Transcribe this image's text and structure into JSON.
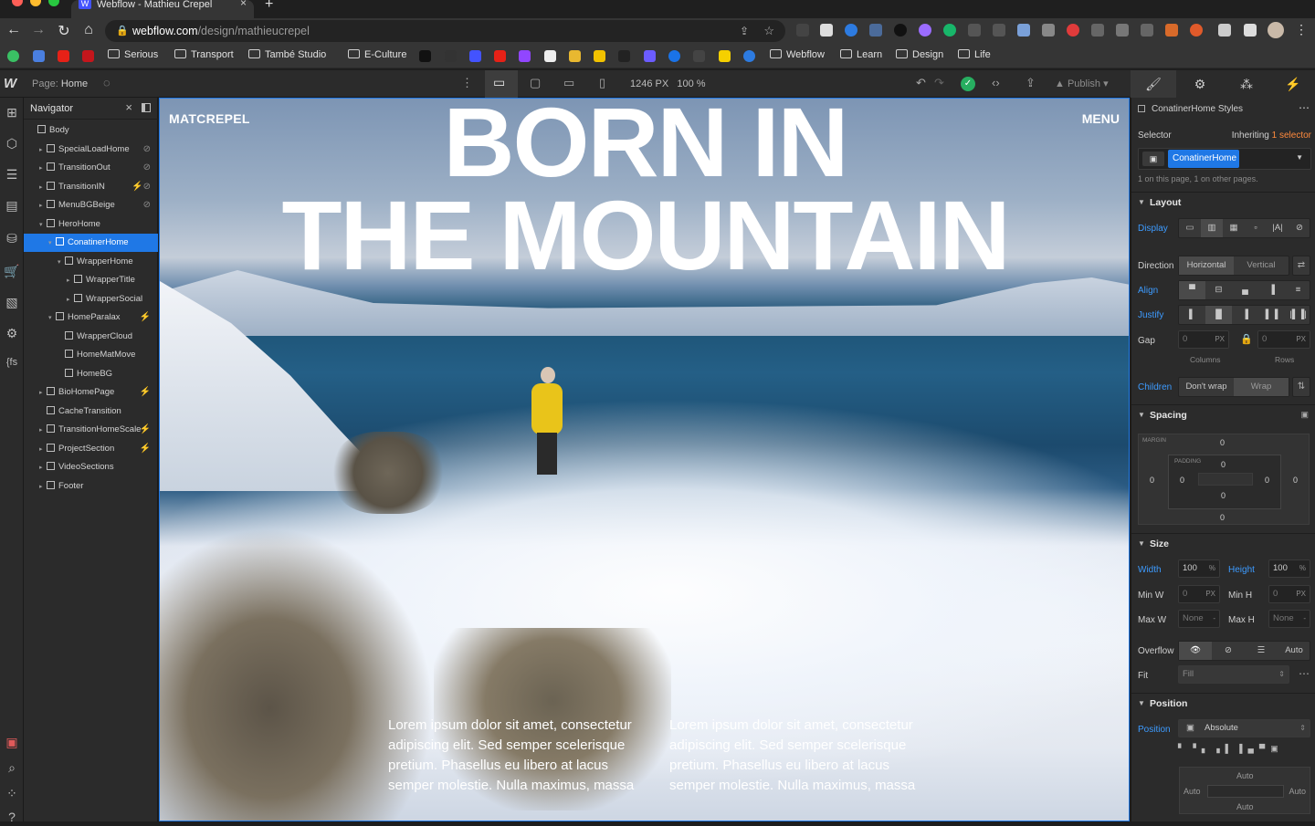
{
  "browser": {
    "tab_title": "Webflow - Mathieu Crepel",
    "tab_favicon": "W",
    "url_host": "webflow.com",
    "url_path": "/design/mathieucrepel",
    "bookmarks": [
      "Serious",
      "Transport",
      "També Studio",
      "E-Culture",
      "Webflow",
      "Learn",
      "Design",
      "Life"
    ]
  },
  "wf_topbar": {
    "page_label": "Page:",
    "page_name": "Home",
    "canvas_width": "1246 PX",
    "zoom": "100 %",
    "publish": "Publish"
  },
  "navigator": {
    "title": "Navigator",
    "items": [
      {
        "label": "Body",
        "depth": 0,
        "caret": "",
        "action": ""
      },
      {
        "label": "SpecialLoadHome",
        "depth": 1,
        "caret": "▸",
        "action": "⊘"
      },
      {
        "label": "TransitionOut",
        "depth": 1,
        "caret": "▸",
        "action": "⊘"
      },
      {
        "label": "TransitionIN",
        "depth": 1,
        "caret": "▸",
        "action": "⚡⊘"
      },
      {
        "label": "MenuBGBeige",
        "depth": 1,
        "caret": "▸",
        "action": "⊘"
      },
      {
        "label": "HeroHome",
        "depth": 1,
        "caret": "▾",
        "action": ""
      },
      {
        "label": "ConatinerHome",
        "depth": 2,
        "caret": "▾",
        "action": ""
      },
      {
        "label": "WrapperHome",
        "depth": 3,
        "caret": "▾",
        "action": ""
      },
      {
        "label": "WrapperTitle",
        "depth": 4,
        "caret": "▸",
        "action": ""
      },
      {
        "label": "WrapperSocial",
        "depth": 4,
        "caret": "▸",
        "action": ""
      },
      {
        "label": "HomeParalax",
        "depth": 2,
        "caret": "▾",
        "action": "⚡"
      },
      {
        "label": "WrapperCloud",
        "depth": 3,
        "caret": "",
        "action": ""
      },
      {
        "label": "HomeMatMove",
        "depth": 3,
        "caret": "",
        "action": ""
      },
      {
        "label": "HomeBG",
        "depth": 3,
        "caret": "",
        "action": ""
      },
      {
        "label": "BioHomePage",
        "depth": 1,
        "caret": "▸",
        "action": "⚡"
      },
      {
        "label": "CacheTransition",
        "depth": 1,
        "caret": "",
        "action": ""
      },
      {
        "label": "TransitionHomeScale",
        "depth": 1,
        "caret": "▸",
        "action": "⚡"
      },
      {
        "label": "ProjectSection",
        "depth": 1,
        "caret": "▸",
        "action": "⚡"
      },
      {
        "label": "VideoSections",
        "depth": 1,
        "caret": "▸",
        "action": ""
      },
      {
        "label": "Footer",
        "depth": 1,
        "caret": "▸",
        "action": ""
      }
    ],
    "selected_index": 6
  },
  "canvas": {
    "brand": "MATCREPEL",
    "menu": "MENU",
    "hero_line1": "BORN IN",
    "hero_line2": "THE MOUNTAIN",
    "paragraph1": "Lorem ipsum dolor sit amet, consectetur adipiscing elit. Sed semper scelerisque pretium. Phasellus eu libero at lacus semper molestie. Nulla maximus, massa",
    "paragraph2": "Lorem ipsum dolor sit amet, consectetur adipiscing elit. Sed semper scelerisque pretium. Phasellus eu libero at lacus semper molestie. Nulla maximus, massa"
  },
  "style_panel": {
    "element_title": "ConatinerHome Styles",
    "selector_label": "Selector",
    "inheriting": "Inheriting",
    "inheriting_count": "1 selector",
    "selector_chip": "ConatinerHome",
    "selector_note": "1 on this page, 1 on other pages.",
    "layout": {
      "title": "Layout",
      "display_label": "Display",
      "direction_label": "Direction",
      "direction_options": [
        "Horizontal",
        "Vertical"
      ],
      "align_label": "Align",
      "justify_label": "Justify",
      "gap_label": "Gap",
      "gap_columns": "0",
      "gap_rows": "0",
      "gap_unit": "PX",
      "columns_label": "Columns",
      "rows_label": "Rows",
      "children_label": "Children",
      "children_options": [
        "Don't wrap",
        "Wrap"
      ]
    },
    "spacing": {
      "title": "Spacing",
      "margin_label": "MARGIN",
      "padding_label": "PADDING",
      "margin_top": "0",
      "margin_right": "0",
      "margin_bottom": "0",
      "margin_left": "0",
      "padding_top": "0",
      "padding_right": "0",
      "padding_bottom": "0",
      "padding_left": "0"
    },
    "size": {
      "title": "Size",
      "width_label": "Width",
      "width_value": "100",
      "width_unit": "%",
      "height_label": "Height",
      "height_value": "100",
      "height_unit": "%",
      "minw_label": "Min W",
      "minw_value": "0",
      "minw_unit": "PX",
      "minh_label": "Min H",
      "minh_value": "0",
      "minh_unit": "PX",
      "maxw_label": "Max W",
      "maxw_value": "None",
      "maxw_unit": "-",
      "maxh_label": "Max H",
      "maxh_value": "None",
      "maxh_unit": "-",
      "overflow_label": "Overflow",
      "overflow_auto": "Auto",
      "fit_label": "Fit",
      "fit_value": "Fill"
    },
    "position": {
      "title": "Position",
      "position_label": "Position",
      "position_value": "Absolute",
      "top": "Auto",
      "left": "Auto",
      "right": "Auto",
      "bottom": "Auto"
    }
  },
  "colors": {
    "accent": "#1f78e6",
    "link_blue": "#3d9bff",
    "panel_bg": "#2b2b2b"
  }
}
